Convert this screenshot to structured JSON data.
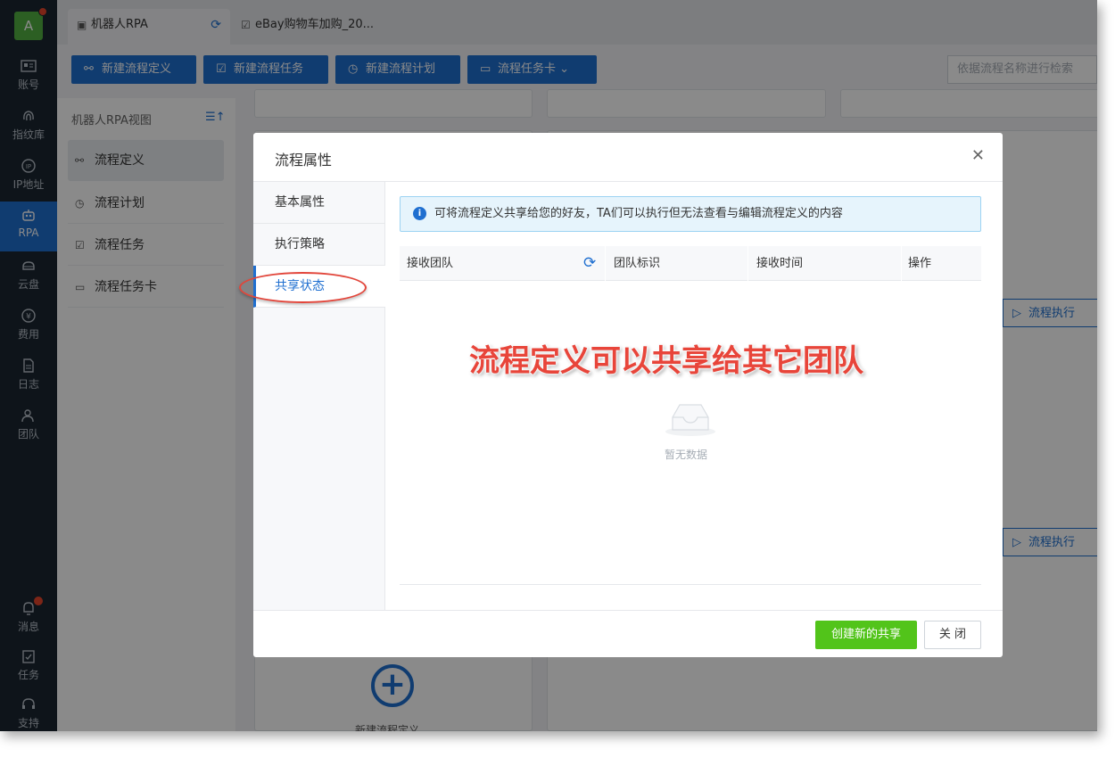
{
  "account": {
    "avatar_letter": "A"
  },
  "rail": {
    "items": [
      {
        "label": "账号",
        "icon": "id-card-icon"
      },
      {
        "label": "指纹库",
        "icon": "fingerprint-icon"
      },
      {
        "label": "IP地址",
        "icon": "ip-icon"
      },
      {
        "label": "RPA",
        "icon": "robot-icon"
      },
      {
        "label": "云盘",
        "icon": "cloud-drive-icon"
      },
      {
        "label": "费用",
        "icon": "yen-icon"
      },
      {
        "label": "日志",
        "icon": "log-icon"
      },
      {
        "label": "团队",
        "icon": "team-icon"
      }
    ],
    "bottom": [
      {
        "label": "消息",
        "icon": "bell-icon"
      },
      {
        "label": "任务",
        "icon": "clipboard-icon"
      },
      {
        "label": "支持",
        "icon": "headset-icon"
      }
    ]
  },
  "tabs": [
    {
      "label": "机器人RPA",
      "active": true
    },
    {
      "label": "eBay购物车加购_20...",
      "active": false
    }
  ],
  "toolbar": {
    "new_definition": "新建流程定义",
    "new_task": "新建流程任务",
    "new_plan": "新建流程计划",
    "task_card": "流程任务卡",
    "search_placeholder": "依据流程名称进行检索"
  },
  "panel": {
    "title": "机器人RPA视图",
    "items": [
      {
        "label": "流程定义",
        "active": true
      },
      {
        "label": "流程计划",
        "active": false
      },
      {
        "label": "流程任务",
        "active": false
      },
      {
        "label": "流程任务卡",
        "active": false
      }
    ]
  },
  "background": {
    "exec_label": "流程执行",
    "add_label": "新建流程定义"
  },
  "modal": {
    "title": "流程属性",
    "nav": [
      {
        "label": "基本属性",
        "active": false
      },
      {
        "label": "执行策略",
        "active": false
      },
      {
        "label": "共享状态",
        "active": true
      }
    ],
    "info": "可将流程定义共享给您的好友，TA们可以执行但无法查看与编辑流程定义的内容",
    "columns": [
      "接收团队",
      "团队标识",
      "接收时间",
      "操作"
    ],
    "empty_text": "暂无数据",
    "caption": "流程定义可以共享给其它团队",
    "create_button": "创建新的共享",
    "close_button": "关 闭"
  },
  "colors": {
    "accent": "#1f6fd0",
    "rail_bg": "#1b2530",
    "success": "#52c41a",
    "caption": "#e8453a"
  }
}
